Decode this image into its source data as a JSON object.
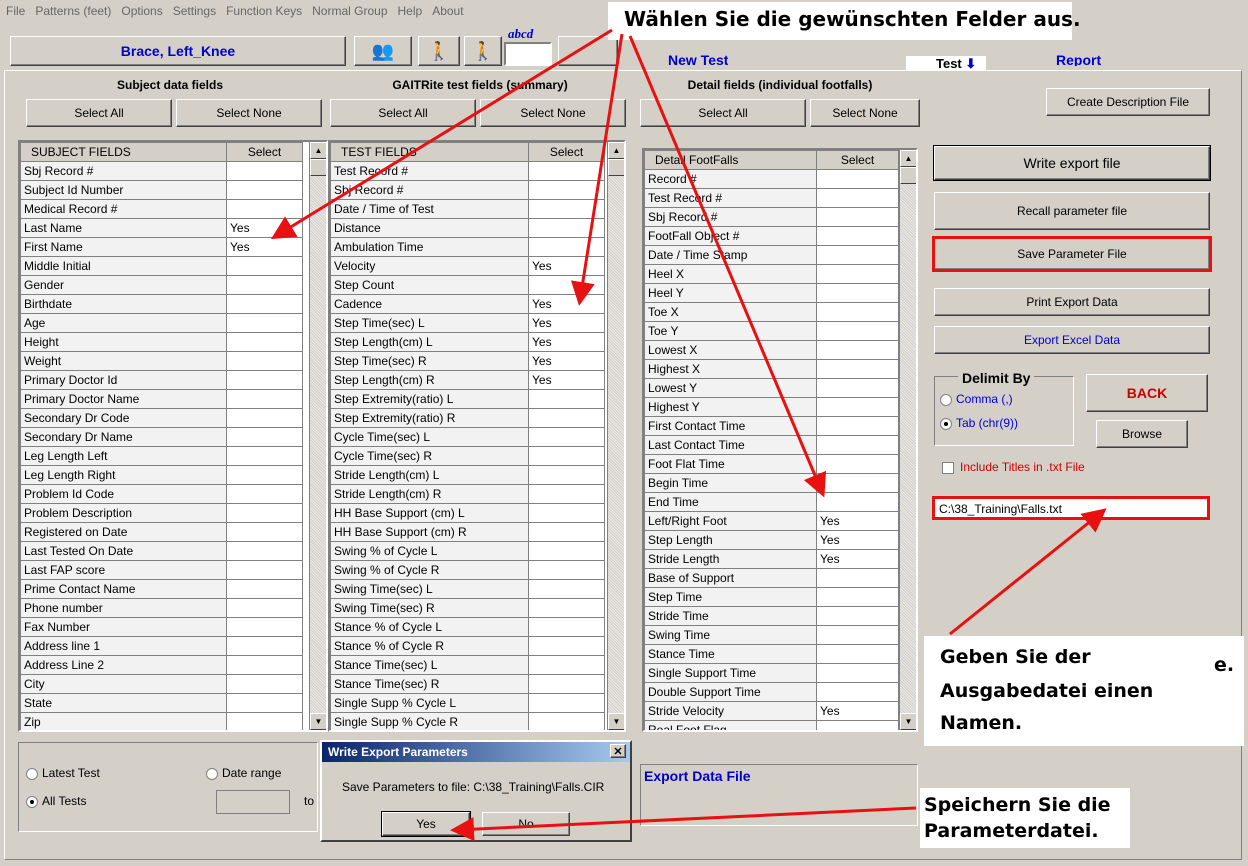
{
  "menu": [
    "File",
    "Patterns (feet)",
    "Options",
    "Settings",
    "Function Keys",
    "Normal Group",
    "Help",
    "About"
  ],
  "top": {
    "patient": "Brace, Left_Knee",
    "abcd": "abcd",
    "new_test": "New Test",
    "test_label": "Test",
    "report": "Report"
  },
  "subject": {
    "title": "Subject data fields",
    "select_all": "Select All",
    "select_none": "Select None",
    "col1": "SUBJECT FIELDS",
    "col2": "Select",
    "rows": [
      [
        "Sbj Record #",
        ""
      ],
      [
        "Subject Id Number",
        ""
      ],
      [
        "Medical Record #",
        ""
      ],
      [
        "Last Name",
        "Yes"
      ],
      [
        "First Name",
        "Yes"
      ],
      [
        "Middle Initial",
        ""
      ],
      [
        "Gender",
        ""
      ],
      [
        "Birthdate",
        ""
      ],
      [
        "Age",
        ""
      ],
      [
        "Height",
        ""
      ],
      [
        "Weight",
        ""
      ],
      [
        "Primary Doctor Id",
        ""
      ],
      [
        "Primary Doctor Name",
        ""
      ],
      [
        "Secondary Dr Code",
        ""
      ],
      [
        "Secondary Dr Name",
        ""
      ],
      [
        "Leg Length Left",
        ""
      ],
      [
        "Leg Length Right",
        ""
      ],
      [
        "Problem Id Code",
        ""
      ],
      [
        "Problem Description",
        ""
      ],
      [
        "Registered on Date",
        ""
      ],
      [
        "Last Tested On Date",
        ""
      ],
      [
        "Last FAP score",
        ""
      ],
      [
        "Prime Contact Name",
        ""
      ],
      [
        "Phone number",
        ""
      ],
      [
        "Fax Number",
        ""
      ],
      [
        "Address line 1",
        ""
      ],
      [
        "Address Line 2",
        ""
      ],
      [
        "City",
        ""
      ],
      [
        "State",
        ""
      ],
      [
        "Zip",
        ""
      ]
    ]
  },
  "gait": {
    "title": "GAITRite test fields (summary)",
    "select_all": "Select All",
    "select_none": "Select None",
    "col1": "TEST FIELDS",
    "col2": "Select",
    "rows": [
      [
        "Test Record #",
        ""
      ],
      [
        "Sbj Record #",
        ""
      ],
      [
        "Date / Time of Test",
        ""
      ],
      [
        "Distance",
        ""
      ],
      [
        "Ambulation Time",
        ""
      ],
      [
        "Velocity",
        "Yes"
      ],
      [
        "Step Count",
        ""
      ],
      [
        "Cadence",
        "Yes"
      ],
      [
        "Step Time(sec) L",
        "Yes"
      ],
      [
        "Step Length(cm) L",
        "Yes"
      ],
      [
        "Step Time(sec) R",
        "Yes"
      ],
      [
        "Step Length(cm) R",
        "Yes"
      ],
      [
        "Step Extremity(ratio) L",
        ""
      ],
      [
        "Step Extremity(ratio) R",
        ""
      ],
      [
        "Cycle Time(sec) L",
        ""
      ],
      [
        "Cycle Time(sec) R",
        ""
      ],
      [
        "Stride Length(cm) L",
        ""
      ],
      [
        "Stride Length(cm) R",
        ""
      ],
      [
        "HH Base Support (cm) L",
        ""
      ],
      [
        "HH Base Support (cm) R",
        ""
      ],
      [
        "Swing % of Cycle L",
        ""
      ],
      [
        "Swing % of Cycle R",
        ""
      ],
      [
        "Swing Time(sec) L",
        ""
      ],
      [
        "Swing Time(sec) R",
        ""
      ],
      [
        "Stance % of Cycle L",
        ""
      ],
      [
        "Stance % of Cycle R",
        ""
      ],
      [
        "Stance Time(sec)  L",
        ""
      ],
      [
        "Stance Time(sec)  R",
        ""
      ],
      [
        "Single Supp % Cycle L",
        ""
      ],
      [
        "Single Supp % Cycle R",
        ""
      ]
    ]
  },
  "detail": {
    "title": "Detail fields (individual footfalls)",
    "select_all": "Select All",
    "select_none": "Select None",
    "col1": "Detail FootFalls",
    "col2": "Select",
    "rows": [
      [
        "Record #",
        ""
      ],
      [
        "Test Record #",
        ""
      ],
      [
        "Sbj Record #",
        ""
      ],
      [
        "FootFall Object #",
        ""
      ],
      [
        "Date / Time Stamp",
        ""
      ],
      [
        "Heel X",
        ""
      ],
      [
        "Heel Y",
        ""
      ],
      [
        "Toe X",
        ""
      ],
      [
        "Toe Y",
        ""
      ],
      [
        "Lowest X",
        ""
      ],
      [
        "Highest X",
        ""
      ],
      [
        "Lowest Y",
        ""
      ],
      [
        "Highest Y",
        ""
      ],
      [
        "First Contact Time",
        ""
      ],
      [
        "Last Contact Time",
        ""
      ],
      [
        "Foot Flat Time",
        ""
      ],
      [
        "Begin Time",
        ""
      ],
      [
        "End Time",
        ""
      ],
      [
        "Left/Right Foot",
        "Yes"
      ],
      [
        "Step Length",
        "Yes"
      ],
      [
        "Stride Length",
        "Yes"
      ],
      [
        "Base of Support",
        ""
      ],
      [
        "Step Time",
        ""
      ],
      [
        "Stride Time",
        ""
      ],
      [
        "Swing Time",
        ""
      ],
      [
        "Stance Time",
        ""
      ],
      [
        "Single Support Time",
        ""
      ],
      [
        "Double Support Time",
        ""
      ],
      [
        "Stride Velocity",
        "Yes"
      ],
      [
        "Real Foot Flag",
        ""
      ]
    ]
  },
  "right": {
    "create_desc": "Create Description File",
    "write_export": "Write export file",
    "recall": "Recall parameter file",
    "save_param": "Save  Parameter File",
    "print_export": "Print Export Data",
    "export_excel": "Export Excel Data",
    "delimit_title": "Delimit By",
    "comma": "Comma (,)",
    "tab": "Tab (chr(9))",
    "back": "BACK",
    "browse": "Browse",
    "include_titles": "Include Titles in .txt File",
    "filename": "C:\\38_Training\\Falls.txt"
  },
  "bottom": {
    "latest": "Latest Test",
    "date_range": "Date range",
    "all_tests": "All Tests",
    "to": "to",
    "export_data_file": "Export Data File"
  },
  "dialog": {
    "title": "Write Export Parameters",
    "message": "Save Parameters to file: C:\\38_Training\\Falls.CIR",
    "yes": "Yes",
    "no": "No"
  },
  "annotations": {
    "top": "Wählen Sie die gewünschten Felder aus.",
    "name_line1": "Geben Sie der",
    "name_line2": "Ausgabedatei einen",
    "name_line3": "Namen.",
    "save_line1": "Speichern Sie die",
    "save_line2": "Parameterdatei.",
    "stray": "e."
  },
  "colors": {
    "arrow": "#e81010",
    "blue_text": "#0000cc",
    "red_text": "#cc0000",
    "highlight_border": "#e81010"
  }
}
